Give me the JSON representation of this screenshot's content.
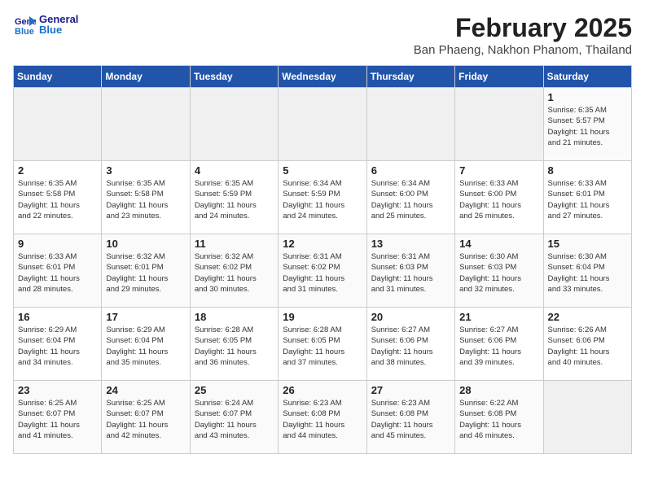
{
  "header": {
    "logo_line1": "General",
    "logo_line2": "Blue",
    "month_title": "February 2025",
    "subtitle": "Ban Phaeng, Nakhon Phanom, Thailand"
  },
  "weekdays": [
    "Sunday",
    "Monday",
    "Tuesday",
    "Wednesday",
    "Thursday",
    "Friday",
    "Saturday"
  ],
  "weeks": [
    [
      {
        "day": "",
        "empty": true
      },
      {
        "day": "",
        "empty": true
      },
      {
        "day": "",
        "empty": true
      },
      {
        "day": "",
        "empty": true
      },
      {
        "day": "",
        "empty": true
      },
      {
        "day": "",
        "empty": true
      },
      {
        "day": "1",
        "info": "Sunrise: 6:35 AM\nSunset: 5:57 PM\nDaylight: 11 hours\nand 21 minutes."
      }
    ],
    [
      {
        "day": "2",
        "info": "Sunrise: 6:35 AM\nSunset: 5:58 PM\nDaylight: 11 hours\nand 22 minutes."
      },
      {
        "day": "3",
        "info": "Sunrise: 6:35 AM\nSunset: 5:58 PM\nDaylight: 11 hours\nand 23 minutes."
      },
      {
        "day": "4",
        "info": "Sunrise: 6:35 AM\nSunset: 5:59 PM\nDaylight: 11 hours\nand 24 minutes."
      },
      {
        "day": "5",
        "info": "Sunrise: 6:34 AM\nSunset: 5:59 PM\nDaylight: 11 hours\nand 24 minutes."
      },
      {
        "day": "6",
        "info": "Sunrise: 6:34 AM\nSunset: 6:00 PM\nDaylight: 11 hours\nand 25 minutes."
      },
      {
        "day": "7",
        "info": "Sunrise: 6:33 AM\nSunset: 6:00 PM\nDaylight: 11 hours\nand 26 minutes."
      },
      {
        "day": "8",
        "info": "Sunrise: 6:33 AM\nSunset: 6:01 PM\nDaylight: 11 hours\nand 27 minutes."
      }
    ],
    [
      {
        "day": "9",
        "info": "Sunrise: 6:33 AM\nSunset: 6:01 PM\nDaylight: 11 hours\nand 28 minutes."
      },
      {
        "day": "10",
        "info": "Sunrise: 6:32 AM\nSunset: 6:01 PM\nDaylight: 11 hours\nand 29 minutes."
      },
      {
        "day": "11",
        "info": "Sunrise: 6:32 AM\nSunset: 6:02 PM\nDaylight: 11 hours\nand 30 minutes."
      },
      {
        "day": "12",
        "info": "Sunrise: 6:31 AM\nSunset: 6:02 PM\nDaylight: 11 hours\nand 31 minutes."
      },
      {
        "day": "13",
        "info": "Sunrise: 6:31 AM\nSunset: 6:03 PM\nDaylight: 11 hours\nand 31 minutes."
      },
      {
        "day": "14",
        "info": "Sunrise: 6:30 AM\nSunset: 6:03 PM\nDaylight: 11 hours\nand 32 minutes."
      },
      {
        "day": "15",
        "info": "Sunrise: 6:30 AM\nSunset: 6:04 PM\nDaylight: 11 hours\nand 33 minutes."
      }
    ],
    [
      {
        "day": "16",
        "info": "Sunrise: 6:29 AM\nSunset: 6:04 PM\nDaylight: 11 hours\nand 34 minutes."
      },
      {
        "day": "17",
        "info": "Sunrise: 6:29 AM\nSunset: 6:04 PM\nDaylight: 11 hours\nand 35 minutes."
      },
      {
        "day": "18",
        "info": "Sunrise: 6:28 AM\nSunset: 6:05 PM\nDaylight: 11 hours\nand 36 minutes."
      },
      {
        "day": "19",
        "info": "Sunrise: 6:28 AM\nSunset: 6:05 PM\nDaylight: 11 hours\nand 37 minutes."
      },
      {
        "day": "20",
        "info": "Sunrise: 6:27 AM\nSunset: 6:06 PM\nDaylight: 11 hours\nand 38 minutes."
      },
      {
        "day": "21",
        "info": "Sunrise: 6:27 AM\nSunset: 6:06 PM\nDaylight: 11 hours\nand 39 minutes."
      },
      {
        "day": "22",
        "info": "Sunrise: 6:26 AM\nSunset: 6:06 PM\nDaylight: 11 hours\nand 40 minutes."
      }
    ],
    [
      {
        "day": "23",
        "info": "Sunrise: 6:25 AM\nSunset: 6:07 PM\nDaylight: 11 hours\nand 41 minutes."
      },
      {
        "day": "24",
        "info": "Sunrise: 6:25 AM\nSunset: 6:07 PM\nDaylight: 11 hours\nand 42 minutes."
      },
      {
        "day": "25",
        "info": "Sunrise: 6:24 AM\nSunset: 6:07 PM\nDaylight: 11 hours\nand 43 minutes."
      },
      {
        "day": "26",
        "info": "Sunrise: 6:23 AM\nSunset: 6:08 PM\nDaylight: 11 hours\nand 44 minutes."
      },
      {
        "day": "27",
        "info": "Sunrise: 6:23 AM\nSunset: 6:08 PM\nDaylight: 11 hours\nand 45 minutes."
      },
      {
        "day": "28",
        "info": "Sunrise: 6:22 AM\nSunset: 6:08 PM\nDaylight: 11 hours\nand 46 minutes."
      },
      {
        "day": "",
        "empty": true
      }
    ]
  ]
}
